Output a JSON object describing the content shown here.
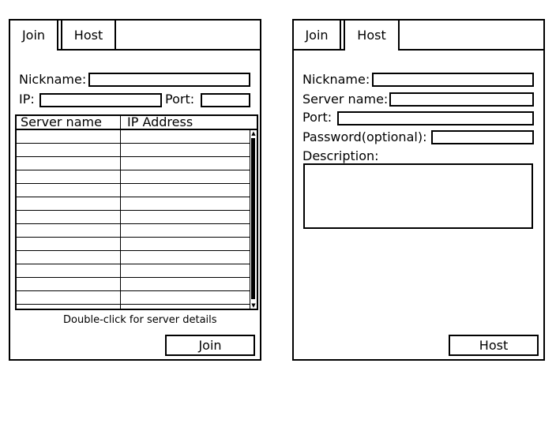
{
  "join_panel": {
    "tabs": [
      {
        "label": "Join"
      },
      {
        "label": "Host"
      }
    ],
    "nickname_label": "Nickname:",
    "ip_label": "IP:",
    "port_label": "Port:",
    "table": {
      "columns": [
        "Server name",
        "IP Address"
      ],
      "row_count": 13
    },
    "hint": "Double-click for server details",
    "join_button": "Join"
  },
  "host_panel": {
    "tabs": [
      {
        "label": "Join"
      },
      {
        "label": "Host"
      }
    ],
    "nickname_label": "Nickname:",
    "server_name_label": "Server name:",
    "port_label": "Port:",
    "password_label": "Password(optional):",
    "description_label": "Description:",
    "host_button": "Host"
  }
}
